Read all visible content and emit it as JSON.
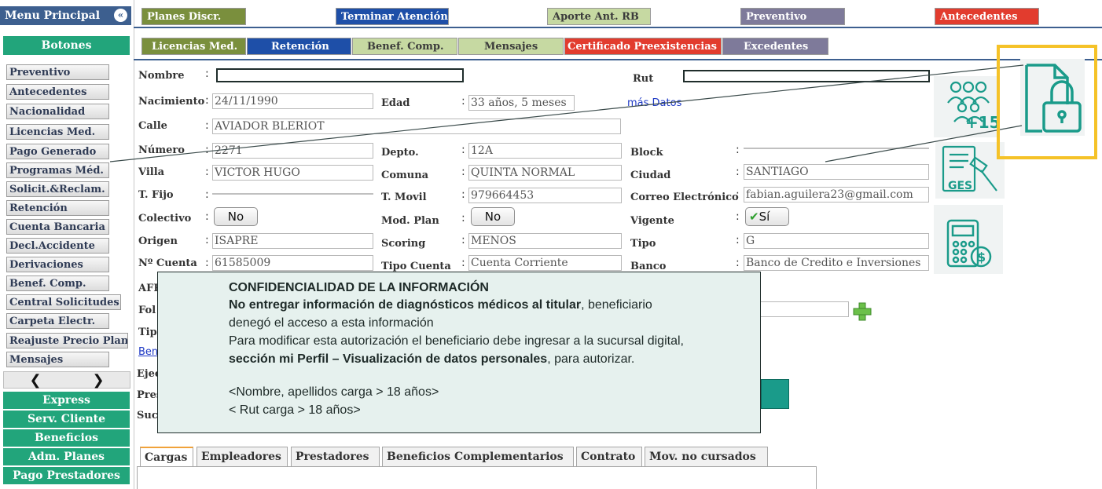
{
  "sidebar": {
    "title": "Menu Principal",
    "collapse": "«",
    "section": "Botones",
    "items": [
      "Preventivo",
      "Antecedentes",
      "Nacionalidad",
      "Licencias Med.",
      "Pago Generado",
      "Programas Méd.",
      "Solicit.&Reclam.",
      "Retención",
      "Cuenta Bancaria",
      "Decl.Accidente",
      "Derivaciones",
      "Benef. Comp.",
      "Central Solicitudes",
      "Carpeta Electr.",
      "Reajuste Precio Plan",
      "Mensajes"
    ],
    "scroll_left": "❮",
    "scroll_right": "❯",
    "groups": [
      "Express",
      "Serv. Cliente",
      "Beneficios",
      "Adm. Planes",
      "Pago Prestadores"
    ]
  },
  "top_tabs_row1": [
    "Planes Discr.",
    "Terminar Atención",
    "Aporte Ant. RB",
    "Preventivo",
    "Antecedentes"
  ],
  "top_tabs_row2": [
    "Licencias Med.",
    "Retención",
    "Benef. Comp.",
    "Mensajes",
    "Certificado Preexistencias",
    "Excedentes"
  ],
  "form": {
    "nombre_label": "Nombre",
    "nombre_value": "",
    "rut_label": "Rut",
    "rut_value": "",
    "nacimiento_label": "Nacimiento",
    "nacimiento_value": "24/11/1990",
    "edad_label": "Edad",
    "edad_value": "33 años, 5 meses",
    "mas_datos": "más Datos",
    "calle_label": "Calle",
    "calle_value": "AVIADOR BLERIOT",
    "numero_label": "Número",
    "numero_value": "2271",
    "depto_label": "Depto.",
    "depto_value": "12A",
    "block_label": "Block",
    "block_value": "",
    "villa_label": "Villa",
    "villa_value": "VICTOR HUGO",
    "comuna_label": "Comuna",
    "comuna_value": "QUINTA NORMAL",
    "ciudad_label": "Ciudad",
    "ciudad_value": "SANTIAGO",
    "tfijo_label": "T. Fijo",
    "tfijo_value": "",
    "tmovil_label": "T. Movil",
    "tmovil_value": "979664453",
    "correo_label": "Correo Electrónico",
    "correo_value": "fabian.aguilera23@gmail.com",
    "colectivo_label": "Colectivo",
    "colectivo_value": "No",
    "modplan_label": "Mod. Plan",
    "modplan_value": "No",
    "vigente_label": "Vigente",
    "vigente_value": "Sí",
    "origen_label": "Origen",
    "origen_value": "ISAPRE",
    "scoring_label": "Scoring",
    "scoring_value": "MENOS",
    "tipo_label": "Tipo",
    "tipo_value": "G",
    "ncuenta_label": "Nº Cuenta",
    "ncuenta_value": "61585009",
    "tipocuenta_label": "Tipo Cuenta",
    "tipocuenta_value": "Cuenta Corriente",
    "banco_label": "Banco",
    "banco_value": "Banco de Credito e Inversiones",
    "partial_labels": [
      "AFP",
      "Fol",
      "Tip",
      "Ben",
      "Ejec",
      "Pres",
      "Suc"
    ]
  },
  "icons": {
    "family": "family-15-icon",
    "ges": "GES",
    "calculator": "calculator-money-icon",
    "lock": "document-lock-icon",
    "family_text": "+15"
  },
  "overlay": {
    "title": "CONFIDENCIALIDAD DE LA INFORMACIÓN",
    "line1_bold": "No entregar información de diagnósticos médicos al titular",
    "line1_rest": ", beneficiario",
    "line2": "denegó el acceso a esta información",
    "line3": "Para modificar esta autorización el beneficiario debe ingresar a la sucursal digital,",
    "line4_bold": "sección mi Perfil – Visualización de datos personales",
    "line4_rest": ", para autorizar.",
    "line5": "<Nombre, apellidos carga > 18 años>",
    "line6": "< Rut carga > 18 años>"
  },
  "bottom_tabs": [
    "Cargas",
    "Empleadores",
    "Prestadores",
    "Beneficios Complementarios",
    "Contrato",
    "Mov. no cursados"
  ],
  "colors": {
    "teal": "#1a9b8a",
    "highlight": "#f5c228",
    "menu_blue": "#3d5f8f",
    "green": "#22a57b"
  }
}
